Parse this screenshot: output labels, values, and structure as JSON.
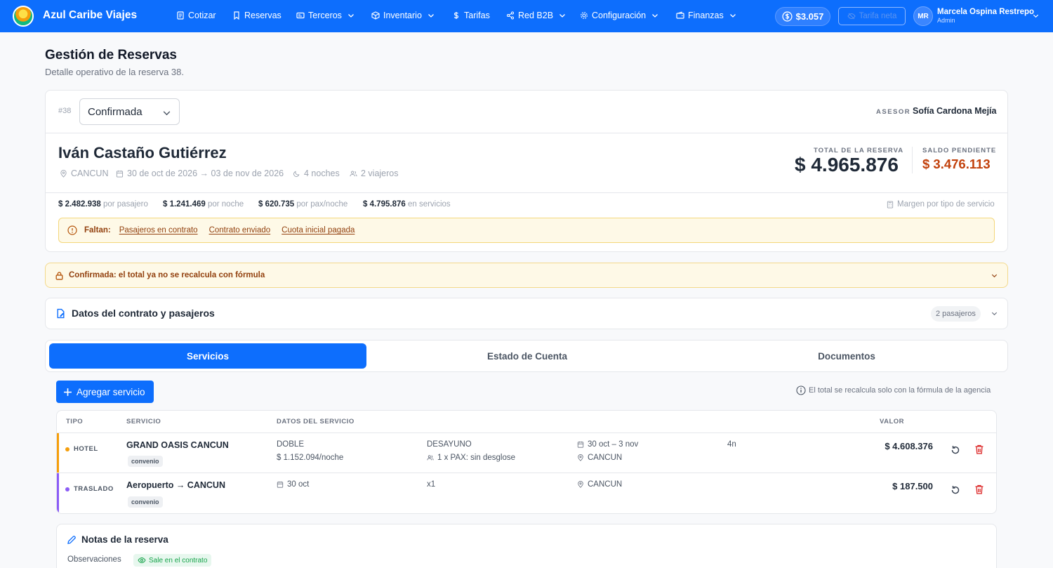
{
  "nav": {
    "brand": "Azul Caribe Viajes",
    "items": [
      {
        "label": "Cotizar",
        "icon": "document-icon",
        "dropdown": false
      },
      {
        "label": "Reservas",
        "icon": "bookmark-icon",
        "dropdown": false
      },
      {
        "label": "Terceros",
        "icon": "id-card-icon",
        "dropdown": true
      },
      {
        "label": "Inventario",
        "icon": "box-icon",
        "dropdown": true
      },
      {
        "label": "Tarifas",
        "icon": "dollar-icon",
        "dropdown": false
      },
      {
        "label": "Red B2B",
        "icon": "share-icon",
        "dropdown": true
      },
      {
        "label": "Configuración",
        "icon": "gear-icon",
        "dropdown": true
      },
      {
        "label": "Finanzas",
        "icon": "wallet-icon",
        "dropdown": true
      }
    ],
    "balance": "$3.057",
    "tarifa_neta": "Tarifa neta",
    "user": {
      "initials": "MR",
      "name": "Marcela Ospina Restrepo",
      "role": "Admin"
    }
  },
  "page": {
    "title": "Gestión de Reservas",
    "subtitle": "Detalle operativo de la reserva 38."
  },
  "reserva": {
    "id": "#38",
    "status": "Confirmada",
    "asesor_label": "ASESOR",
    "asesor": "Sofía Cardona Mejía",
    "client": "Iván Castaño Gutiérrez",
    "destination": "CANCUN",
    "dates": "30 de oct de 2026 → 03 de nov de 2026",
    "nights": "4 noches",
    "travelers": "2 viajeros",
    "total_label": "TOTAL DE LA RESERVA",
    "total": "$ 4.965.876",
    "saldo_label": "SALDO PENDIENTE",
    "saldo": "$ 3.476.113",
    "stats": [
      {
        "value": "$ 2.482.938",
        "unit": "por pasajero"
      },
      {
        "value": "$ 1.241.469",
        "unit": "por noche"
      },
      {
        "value": "$ 620.735",
        "unit": "por pax/noche"
      },
      {
        "value": "$ 4.795.876",
        "unit": "en servicios"
      }
    ],
    "margin_link": "Margen por tipo de servicio",
    "faltan_label": "Faltan:",
    "faltan": [
      "Pasajeros en contrato",
      "Contrato enviado",
      "Cuota inicial pagada"
    ]
  },
  "lock_notice": "Confirmada: el total ya no se recalcula con fórmula",
  "contract": {
    "title": "Datos del contrato y pasajeros",
    "badge": "2 pasajeros"
  },
  "tabs": [
    "Servicios",
    "Estado de Cuenta",
    "Documentos"
  ],
  "services": {
    "add_label": "Agregar servicio",
    "formula_note": "El total se recalcula solo con la fórmula de la agencia",
    "headers": {
      "tipo": "TIPO",
      "servicio": "SERVICIO",
      "datos": "DATOS DEL SERVICIO",
      "valor": "VALOR"
    },
    "rows": [
      {
        "type": "HOTEL",
        "color": "#f59e0b",
        "name": "GRAND OASIS CANCUN",
        "badge": "convenio",
        "d1": "DOBLE",
        "d1b": "$ 1.152.094/noche",
        "d2": "DESAYUNO",
        "d2b": "1 x PAX: sin desglose",
        "date": "30 oct – 3 nov",
        "city": "CANCUN",
        "nights": "4n",
        "value": "$ 4.608.376"
      },
      {
        "type": "TRASLADO",
        "color": "#8b5cf6",
        "name": "Aeropuerto → CANCUN",
        "badge": "convenio",
        "d1": "30 oct",
        "d2": "x1",
        "city": "CANCUN",
        "value": "$ 187.500"
      }
    ]
  },
  "notes": {
    "title": "Notas de la reserva",
    "obs_label": "Observaciones",
    "obs_badge": "Sale en el contrato"
  }
}
